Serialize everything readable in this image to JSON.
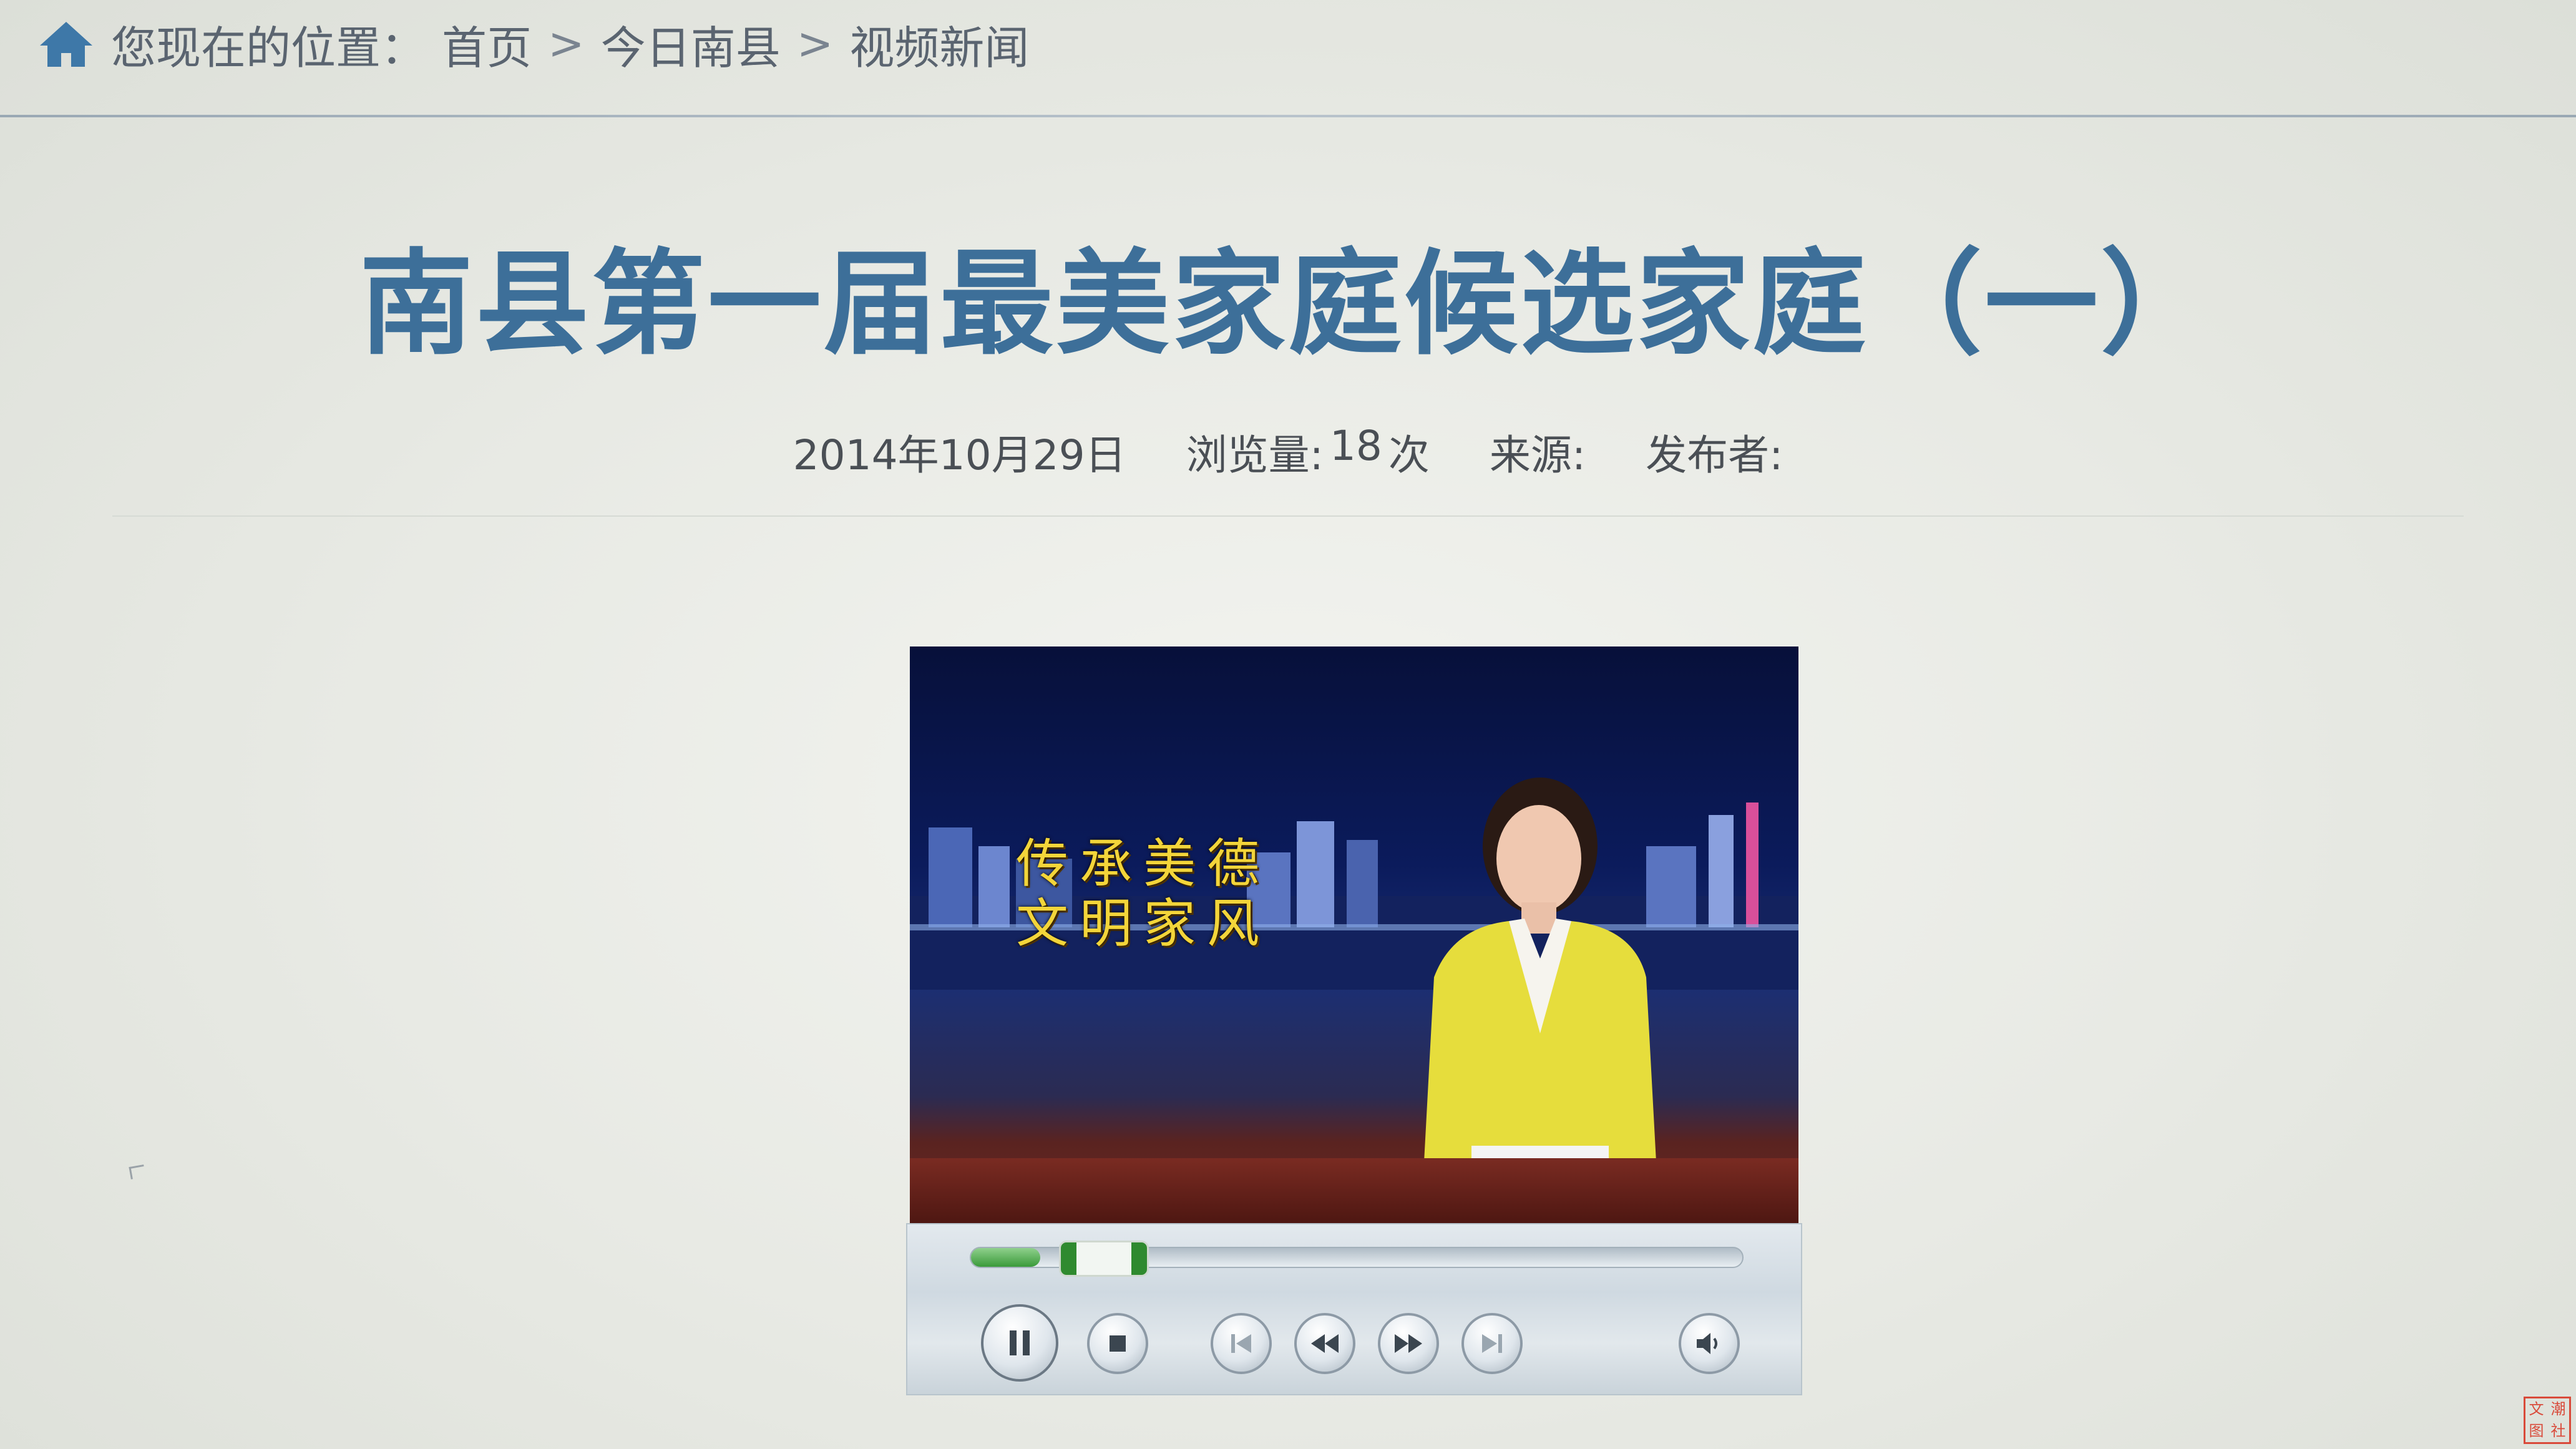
{
  "breadcrumb": {
    "prefix": "您现在的位置：",
    "items": [
      "首页",
      "今日南县",
      "视频新闻"
    ],
    "separator": ">"
  },
  "article": {
    "title": "南县第一届最美家庭候选家庭（一）",
    "date": "2014年10月29日",
    "views_label": "浏览量:",
    "views_value": "18",
    "views_unit": "次",
    "source_label": "来源:",
    "publisher_label": "发布者:"
  },
  "video": {
    "caption_line1": "传承美德",
    "caption_line2": "文明家风",
    "progress": 0.09
  },
  "player_controls": {
    "icons": [
      "pause-icon",
      "stop-icon",
      "previous-icon",
      "rewind-icon",
      "fast-forward-icon",
      "next-icon",
      "volume-icon"
    ]
  },
  "seal": {
    "chars": [
      "文",
      "潮",
      "图",
      "社"
    ]
  },
  "colors": {
    "title": "#3d6f99",
    "breadcrumb": "#5a6470",
    "caption": "#f3d53a",
    "progress_green": "#3a9a3a"
  }
}
